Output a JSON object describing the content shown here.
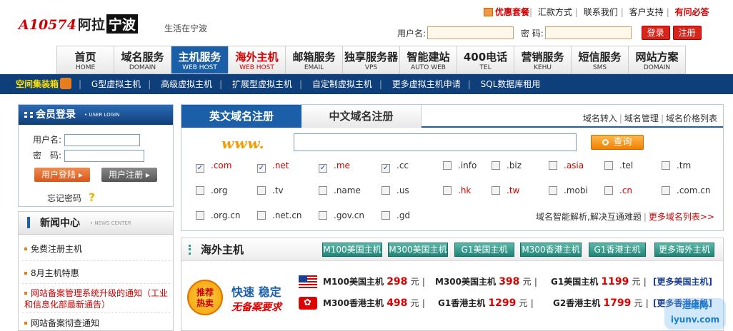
{
  "logo": {
    "part1": "A10574",
    "part2": "阿拉",
    "part3": "宁波"
  },
  "slogan": "生活在宁波",
  "top_links": {
    "promo": "优惠套餐",
    "remit": "汇款方式",
    "contact": "联系我们",
    "support": "客户支持",
    "help": "有问必答"
  },
  "top_login": {
    "username_label": "用户名:",
    "password_label": "密 码:",
    "login_btn": "登录",
    "register_btn": "注册"
  },
  "nav": [
    {
      "cn": "首页",
      "en": "HOME"
    },
    {
      "cn": "域名服务",
      "en": "DOMAIN"
    },
    {
      "cn": "主机服务",
      "en": "WEB HOST"
    },
    {
      "cn": "海外主机",
      "en": "WEB HOST"
    },
    {
      "cn": "邮箱服务",
      "en": "EMAIL"
    },
    {
      "cn": "独享服务器",
      "en": "VPS"
    },
    {
      "cn": "智能建站",
      "en": "AUTO WEB"
    },
    {
      "cn": "400电话",
      "en": "TEL"
    },
    {
      "cn": "营销服务",
      "en": "KEHU"
    },
    {
      "cn": "短信服务",
      "en": "SMS"
    },
    {
      "cn": "网站方案",
      "en": "DOMAIN"
    }
  ],
  "subnav": {
    "hot": "空间集装箱",
    "items": [
      "G型虚拟主机",
      "高级虚拟主机",
      "扩展型虚拟主机",
      "自定制虚拟主机",
      "更多虚拟主机申请",
      "SQL数据库租用"
    ]
  },
  "member": {
    "title": "会员登录",
    "title_en": "• USER LOGIN",
    "username": "用户名:",
    "password": "密　码:",
    "login": "用户登陆",
    "register": "用户注册",
    "forgot": "忘记密码",
    "q": "?"
  },
  "news": {
    "title": "新闻中心",
    "title_en": "• NEWS CENTER",
    "items": [
      "免费注册主机",
      "8月主机特惠",
      "网站备案管理系统升级的通知（工业和信息化部最新通告）",
      "网站备案彻查通知"
    ]
  },
  "domain": {
    "tab_active": "英文域名注册",
    "tab_inactive": "中文域名注册",
    "links": [
      "域名转入",
      "域名管理",
      "域名价格列表"
    ],
    "www": "www.",
    "query": "查询",
    "tlds": [
      ".com",
      ".net",
      ".me",
      ".cc",
      ".info",
      ".biz",
      ".asia",
      ".tel",
      ".tm",
      ".org",
      ".tv",
      ".name",
      ".us",
      ".hk",
      ".tw",
      ".mobi",
      ".cn",
      ".com.cn",
      ".org.cn",
      ".net.cn",
      ".gov.cn",
      ".gd"
    ],
    "note": "域名智能解析,解决互通难题",
    "more": "更多域名列表>>"
  },
  "host": {
    "title": "海外主机",
    "buttons": [
      "M100美国主机",
      "M300美国主机",
      "G1美国主机",
      "M300香港主机",
      "G1香港主机",
      "更多海外主机"
    ],
    "badge_1": "推荐",
    "badge_2": "热卖",
    "slogan_1": "快速 稳定",
    "slogan_2": "无备案要求",
    "us": [
      {
        "name": "M100美国主机",
        "price": "298"
      },
      {
        "name": "M300美国主机",
        "price": "398"
      },
      {
        "name": "G1美国主机",
        "price": "1199"
      }
    ],
    "hk": [
      {
        "name": "M300香港主机",
        "price": "498"
      },
      {
        "name": "G1香港主机",
        "price": "1299"
      },
      {
        "name": "G2香港主机",
        "price": "1799"
      }
    ],
    "unit": "元",
    "more_us": "[更多美国主机]",
    "more_hk": "[更多香港主机]"
  },
  "watermark": {
    "line1": "运维网",
    "line2": "iyunv.com"
  }
}
